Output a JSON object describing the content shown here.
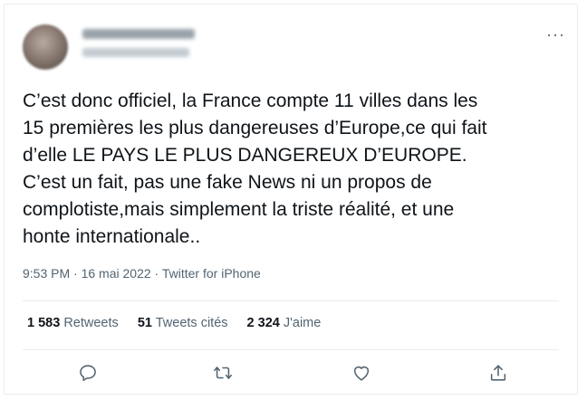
{
  "tweet": {
    "text": "C’est donc officiel, la France compte 11 villes dans les\n15 premières les plus dangereuses d’Europe,ce qui fait\nd’elle LE PAYS LE PLUS DANGEREUX D’EUROPE.\nC’est un fait, pas une fake News ni un propos de\ncomplotiste,mais simplement la triste réalité, et une\nhonte internationale..",
    "time": "9:53 PM",
    "date": "16 mai 2022",
    "separator": "·",
    "source": "Twitter for iPhone"
  },
  "stats": {
    "retweets_count": "1 583",
    "retweets_label": "Retweets",
    "quotes_count": "51",
    "quotes_label": "Tweets cités",
    "likes_count": "2 324",
    "likes_label": "J'aime"
  },
  "menu": {
    "more_label": "···"
  },
  "icons": {
    "reply": "reply-icon",
    "retweet": "retweet-icon",
    "like": "heart-icon",
    "share": "share-icon"
  },
  "colors": {
    "text": "#0f1419",
    "secondary": "#536471",
    "border": "#e6ecf0"
  }
}
